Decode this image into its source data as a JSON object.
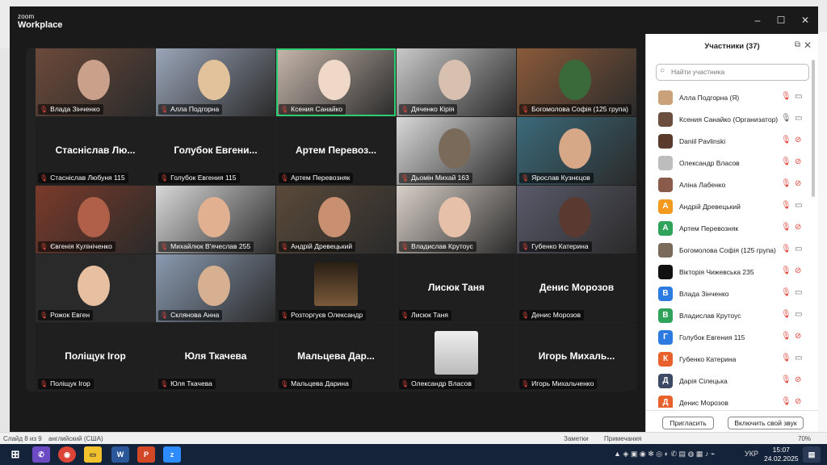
{
  "zoom": {
    "brand_small": "zoom",
    "brand_big": "Workplace",
    "window_controls": {
      "minimize": "–",
      "maximize": "☐",
      "close": "✕"
    }
  },
  "tiles": [
    {
      "name": "Влада Зінченко",
      "display": "",
      "video": true
    },
    {
      "name": "Алла Подгорна",
      "display": "",
      "video": true
    },
    {
      "name": "Ксения Санайко",
      "display": "",
      "video": true,
      "active": true
    },
    {
      "name": "Дяченко Кірія",
      "display": "",
      "video": true
    },
    {
      "name": "Богомолова Софія (125 група)",
      "display": "",
      "video": true
    },
    {
      "name": "Стасніслав Любуня 115",
      "display": "Стасніслав Лю...",
      "video": false
    },
    {
      "name": "Голубок Евгения 115",
      "display": "Голубок Евгени...",
      "video": false
    },
    {
      "name": "Артем Перевозняк",
      "display": "Артем Перевоз...",
      "video": false
    },
    {
      "name": "Дьомін Михай 163",
      "display": "",
      "video": true
    },
    {
      "name": "Ярослав Кузнєцов",
      "display": "",
      "video": true
    },
    {
      "name": "Євгенія Кулініченко",
      "display": "",
      "video": true
    },
    {
      "name": "Михайлюк В'ячеслав 255",
      "display": "",
      "video": true
    },
    {
      "name": "Андрій Древецький",
      "display": "",
      "video": true
    },
    {
      "name": "Владислав Крутоус",
      "display": "",
      "video": true
    },
    {
      "name": "Губенко Катерина",
      "display": "",
      "video": true
    },
    {
      "name": "Рожок Евген",
      "display": "",
      "video": true
    },
    {
      "name": "Склянова Анна",
      "display": "",
      "video": true
    },
    {
      "name": "Розторгуєв Олександр",
      "display": "",
      "video": false,
      "avatar": true
    },
    {
      "name": "Лисюк Таня",
      "display": "Лисюк Таня",
      "video": false
    },
    {
      "name": "Денис Морозов",
      "display": "Денис Морозов",
      "video": false
    },
    {
      "name": "Поліщук Ігор",
      "display": "Поліщук Ігор",
      "video": false
    },
    {
      "name": "Юля Ткачева",
      "display": "Юля Ткачева",
      "video": false
    },
    {
      "name": "Мальцева Дарина",
      "display": "Мальцева Дар...",
      "video": false
    },
    {
      "name": "Олександр Власов",
      "display": "",
      "video": false,
      "avatar": true
    },
    {
      "name": "Игорь Михальченко",
      "display": "Игорь Михаль...",
      "video": false
    }
  ],
  "participants_panel": {
    "title": "Участники (37)",
    "search_placeholder": "Найти участника",
    "invite_label": "Пригласить",
    "unmute_label": "Включить свой звук",
    "rows": [
      {
        "name": "Алла Подгорна (Я)",
        "initial": "",
        "color": "#c9a27a",
        "mic": "muted",
        "cam": "on"
      },
      {
        "name": "Ксения Санайко (Организатор)",
        "initial": "",
        "color": "#6b4e3d",
        "mic": "on",
        "cam": "on"
      },
      {
        "name": "Daniil Pavlinski",
        "initial": "",
        "color": "#5a3a2a",
        "mic": "muted",
        "cam": "off"
      },
      {
        "name": "Олександр Власов",
        "initial": "",
        "color": "#bdbdbd",
        "mic": "muted",
        "cam": "off"
      },
      {
        "name": "Аліна Лабенко",
        "initial": "",
        "color": "#8a5a4a",
        "mic": "muted",
        "cam": "off"
      },
      {
        "name": "Андрій Древецький",
        "initial": "А",
        "color": "#f39a1e",
        "mic": "muted",
        "cam": "on"
      },
      {
        "name": "Артем Перевозняк",
        "initial": "А",
        "color": "#2fa35a",
        "mic": "muted",
        "cam": "off"
      },
      {
        "name": "Богомолова Софія (125 група)",
        "initial": "",
        "color": "#7a6a5a",
        "mic": "muted",
        "cam": "on"
      },
      {
        "name": "Вікторія Чижевська 235",
        "initial": "",
        "color": "#111111",
        "mic": "muted",
        "cam": "off"
      },
      {
        "name": "Влада Зінченко",
        "initial": "В",
        "color": "#2d7be0",
        "mic": "muted",
        "cam": "on"
      },
      {
        "name": "Владислав Крутоус",
        "initial": "В",
        "color": "#2fa35a",
        "mic": "muted",
        "cam": "on"
      },
      {
        "name": "Голубок Евгения 115",
        "initial": "Г",
        "color": "#2d7be0",
        "mic": "muted",
        "cam": "off"
      },
      {
        "name": "Губенко Катерина",
        "initial": "К",
        "color": "#e8602c",
        "mic": "muted",
        "cam": "on"
      },
      {
        "name": "Дарія Сілецька",
        "initial": "Д",
        "color": "#3c4a66",
        "mic": "muted",
        "cam": "off"
      },
      {
        "name": "Денис Морозов",
        "initial": "Д",
        "color": "#e8602c",
        "mic": "muted",
        "cam": "off"
      }
    ]
  },
  "powerpoint": {
    "slide_info": "Слайд 8 из 9",
    "language": "английский (США)",
    "notes": "Заметки",
    "comments": "Примечания",
    "zoom_level": "70%"
  },
  "taskbar": {
    "time": "15:07",
    "date": "24.02.2025",
    "lang": "УКР"
  }
}
